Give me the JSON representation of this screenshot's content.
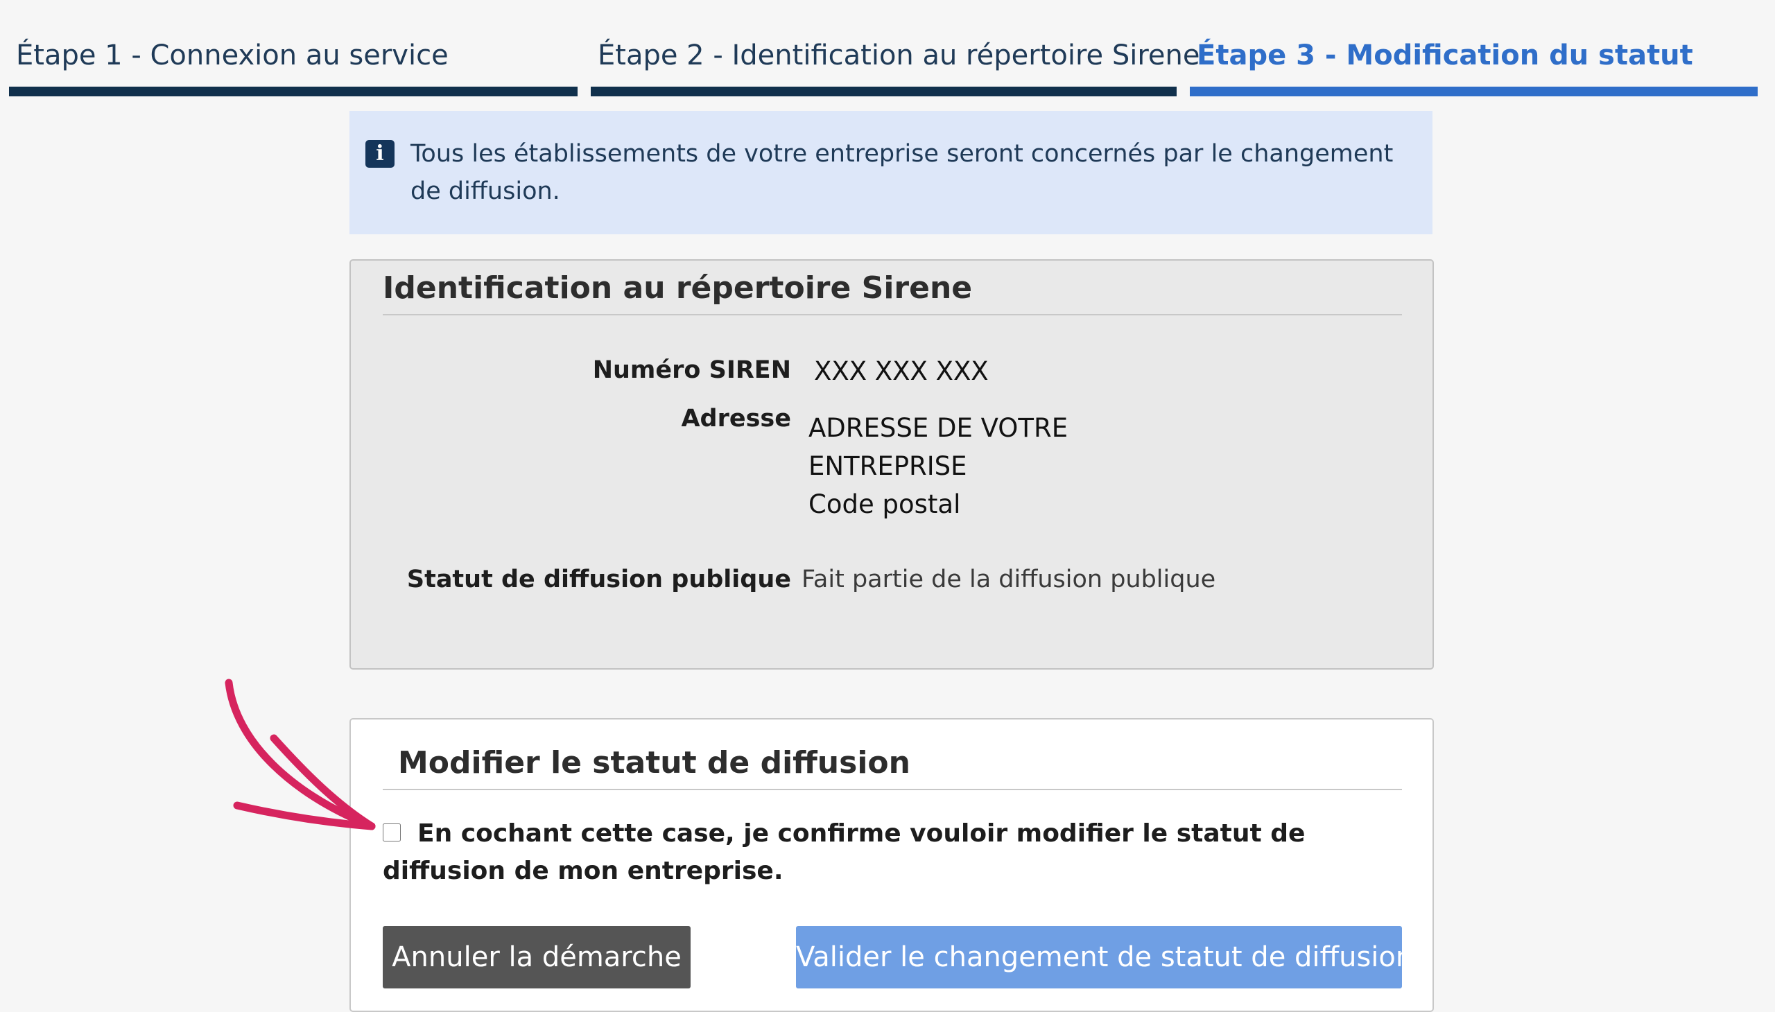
{
  "steps": [
    {
      "label": "Étape 1 - Connexion au service",
      "state": "done"
    },
    {
      "label": "Étape 2 - Identification au répertoire Sirene",
      "state": "done"
    },
    {
      "label": "Étape 3 - Modification du statut",
      "state": "active"
    }
  ],
  "info_banner": {
    "icon": "info-icon",
    "icon_glyph": "i",
    "text": "Tous les établissements de votre entreprise seront concernés par le changement de diffusion."
  },
  "identification": {
    "title": "Identification au répertoire Sirene",
    "siren_label": "Numéro SIREN",
    "siren_value": "XXX XXX XXX",
    "adresse_label": "Adresse",
    "adresse_line1": "ADRESSE DE VOTRE",
    "adresse_line2": "ENTREPRISE",
    "adresse_line3": "Code postal",
    "statut_label": "Statut de diffusion publique",
    "statut_value": "Fait partie de la diffusion publique"
  },
  "modify": {
    "title": "Modifier le statut de diffusion",
    "checkbox_checked": false,
    "checkbox_label": "En cochant cette case, je confirme vouloir modifier le statut de diffusion de mon entreprise.",
    "cancel_label": "Annuler la démarche",
    "validate_label": "Valider le changement de statut de diffusion"
  },
  "annotation": {
    "icon": "annotation-arrow-icon",
    "color": "#d6245e"
  },
  "colors": {
    "background": "#f6f6f6",
    "step_done": "#10304c",
    "step_active": "#2f6ec9",
    "info_background": "#dde7f9",
    "cancel_button": "#555555",
    "validate_button": "#6f9fe4"
  }
}
